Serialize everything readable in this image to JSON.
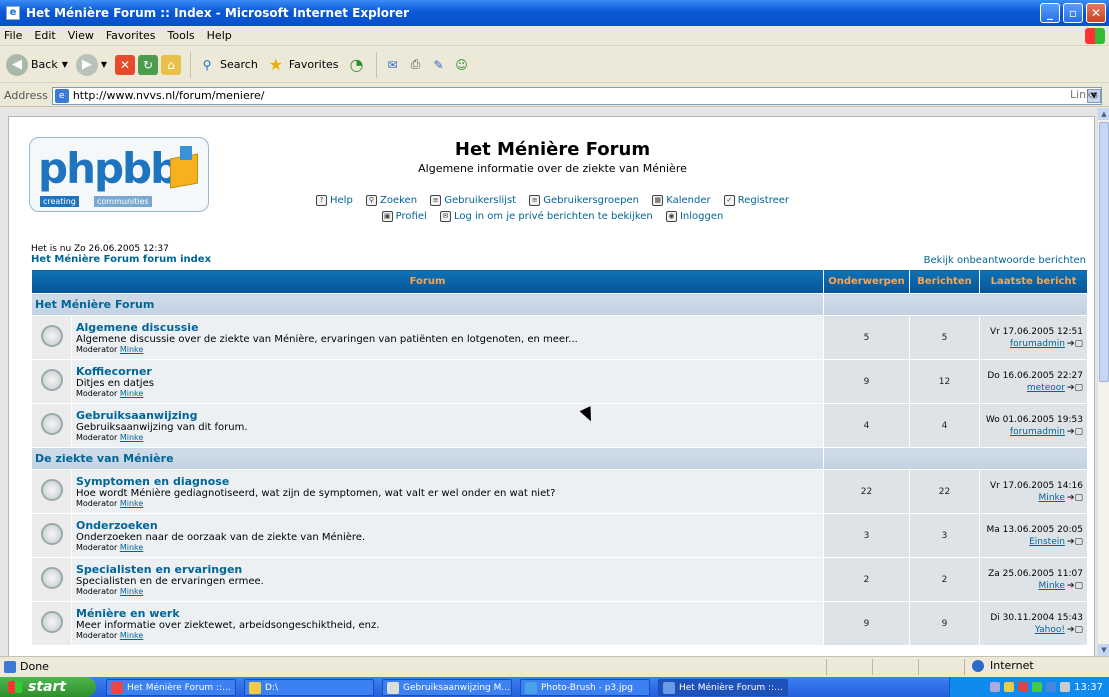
{
  "window": {
    "title": "Het Ménière Forum :: Index - Microsoft Internet Explorer",
    "menu": [
      "File",
      "Edit",
      "View",
      "Favorites",
      "Tools",
      "Help"
    ],
    "toolbar": {
      "back": "Back",
      "search": "Search",
      "favorites": "Favorites"
    },
    "address_label": "Address",
    "address": "http://www.nvvs.nl/forum/meniere/",
    "links_label": "Links"
  },
  "page": {
    "title": "Het Ménière Forum",
    "description": "Algemene informatie over de ziekte van Ménière",
    "nav1": [
      "Help",
      "Zoeken",
      "Gebruikerslijst",
      "Gebruikersgroepen",
      "Kalender",
      "Registreer"
    ],
    "nav2": [
      "Profiel",
      "Log in om je privé berichten te bekijken",
      "Inloggen"
    ],
    "date_line": "Het is nu Zo 26.06.2005 12:37",
    "index_link": "Het Ménière Forum forum index",
    "unanswered_link": "Bekijk onbeantwoorde berichten",
    "table_headers": [
      "Forum",
      "Onderwerpen",
      "Berichten",
      "Laatste bericht"
    ],
    "categories": [
      {
        "name": "Het Ménière Forum",
        "forums": [
          {
            "name": "Algemene discussie",
            "desc": "Algemene discussie over de ziekte van Ménière, ervaringen van patiënten en lotgenoten, en meer...",
            "mod_label": "Moderator",
            "mod": "Minke",
            "topics": "5",
            "posts": "5",
            "last_date": "Vr 17.06.2005 12:51",
            "last_user": "forumadmin"
          },
          {
            "name": "Koffiecorner",
            "desc": "Ditjes en datjes",
            "mod_label": "Moderator",
            "mod": "Minke",
            "topics": "9",
            "posts": "12",
            "last_date": "Do 16.06.2005 22:27",
            "last_user": "meteoor"
          },
          {
            "name": "Gebruiksaanwijzing",
            "desc": "Gebruiksaanwijzing van dit forum.",
            "mod_label": "Moderator",
            "mod": "Minke",
            "topics": "4",
            "posts": "4",
            "last_date": "Wo 01.06.2005 19:53",
            "last_user": "forumadmin"
          }
        ]
      },
      {
        "name": "De ziekte van Ménière",
        "forums": [
          {
            "name": "Symptomen en diagnose",
            "desc": "Hoe wordt Ménière gediagnotiseerd, wat zijn de symptomen, wat valt er wel onder en wat niet?",
            "mod_label": "Moderator",
            "mod": "Minke",
            "topics": "22",
            "posts": "22",
            "last_date": "Vr 17.06.2005 14:16",
            "last_user": "Minke"
          },
          {
            "name": "Onderzoeken",
            "desc": "Onderzoeken naar de oorzaak van de ziekte van Ménière.",
            "mod_label": "Moderator",
            "mod": "Minke",
            "topics": "3",
            "posts": "3",
            "last_date": "Ma 13.06.2005 20:05",
            "last_user": "Einstein"
          },
          {
            "name": "Specialisten en ervaringen",
            "desc": "Specialisten en de ervaringen ermee.",
            "mod_label": "Moderator",
            "mod": "Minke",
            "topics": "2",
            "posts": "2",
            "last_date": "Za 25.06.2005 11:07",
            "last_user": "Minke"
          },
          {
            "name": "Ménière en werk",
            "desc": "Meer informatie over ziektewet, arbeidsongeschiktheid, enz.",
            "mod_label": "Moderator",
            "mod": "Minke",
            "topics": "9",
            "posts": "9",
            "last_date": "Di 30.11.2004 15:43",
            "last_user": "Yahoo!"
          }
        ]
      }
    ]
  },
  "statusbar": {
    "status": "Done",
    "zone": "Internet"
  },
  "taskbar": {
    "start": "start",
    "tasks": [
      "Het Ménière Forum ::...",
      "D:\\",
      "Gebruiksaanwijzing M...",
      "Photo-Brush - p3.jpg",
      "Het Ménière Forum ::..."
    ],
    "clock": "13:37"
  }
}
